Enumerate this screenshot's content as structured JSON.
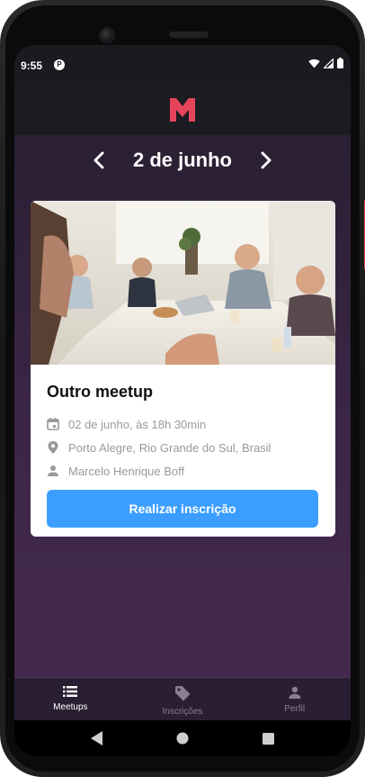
{
  "status_bar": {
    "time": "9:55",
    "notification_glyph": "P",
    "icons": [
      "wifi-icon",
      "signal-icon",
      "battery-icon"
    ]
  },
  "header": {
    "logo_letter": "M",
    "logo_color": "#e5455a"
  },
  "date_nav": {
    "current_date": "2 de junho",
    "prev_icon": "chevron-left-icon",
    "next_icon": "chevron-right-icon"
  },
  "meetup": {
    "title": "Outro meetup",
    "date": "02 de junho, às 18h 30min",
    "location": "Porto Alegre, Rio Grande do Sul, Brasil",
    "organizer": "Marcelo Henrique Boff",
    "button_label": "Realizar inscrição",
    "button_color": "#3b9eff"
  },
  "tabs": [
    {
      "label": "Meetups",
      "icon": "list-icon",
      "active": true
    },
    {
      "label": "Inscrições",
      "icon": "tag-icon",
      "active": false
    },
    {
      "label": "Perfil",
      "icon": "person-icon",
      "active": false
    }
  ],
  "android_nav": [
    "back-icon",
    "home-icon",
    "recents-icon"
  ]
}
